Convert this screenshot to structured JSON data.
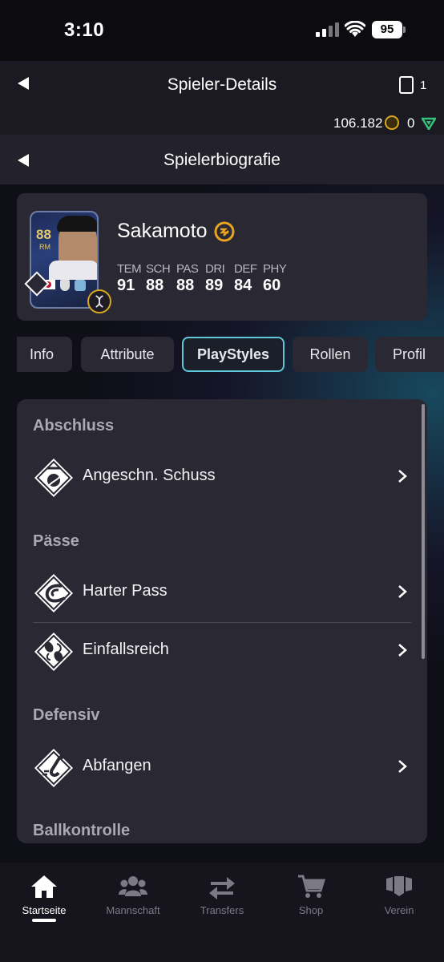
{
  "status_bar": {
    "time": "3:10",
    "battery": "95"
  },
  "header": {
    "title": "Spieler-Details",
    "card_count": "1",
    "coins": "106.182",
    "points": "0"
  },
  "subheader": {
    "title": "Spielerbiografie"
  },
  "player": {
    "rating": "88",
    "position": "RM",
    "name": "Sakamoto",
    "stats": [
      {
        "label": "TEM",
        "value": "91"
      },
      {
        "label": "SCH",
        "value": "88"
      },
      {
        "label": "PAS",
        "value": "88"
      },
      {
        "label": "DRI",
        "value": "89"
      },
      {
        "label": "DEF",
        "value": "84"
      },
      {
        "label": "PHY",
        "value": "60"
      }
    ]
  },
  "tabs": [
    {
      "label": "Info"
    },
    {
      "label": "Attribute"
    },
    {
      "label": "PlayStyles",
      "active": true
    },
    {
      "label": "Rollen"
    },
    {
      "label": "Profil"
    }
  ],
  "playstyles": {
    "categories": [
      {
        "name": "Abschluss",
        "items": [
          {
            "label": "Angeschn. Schuss",
            "icon": "curve-shot-icon"
          }
        ]
      },
      {
        "name": "Pässe",
        "items": [
          {
            "label": "Harter Pass",
            "icon": "hard-pass-icon"
          },
          {
            "label": "Einfallsreich",
            "icon": "inventive-icon"
          }
        ]
      },
      {
        "name": "Defensiv",
        "items": [
          {
            "label": "Abfangen",
            "icon": "intercept-icon"
          }
        ]
      },
      {
        "name": "Ballkontrolle",
        "items": []
      }
    ]
  },
  "nav": [
    {
      "label": "Startseite",
      "icon": "home-icon",
      "active": true
    },
    {
      "label": "Mannschaft",
      "icon": "team-icon"
    },
    {
      "label": "Transfers",
      "icon": "transfers-icon"
    },
    {
      "label": "Shop",
      "icon": "shop-icon"
    },
    {
      "label": "Verein",
      "icon": "club-icon"
    }
  ],
  "colors": {
    "accent": "#5ec7d8",
    "gold": "#d9a81f",
    "panel": "#2a2933"
  }
}
